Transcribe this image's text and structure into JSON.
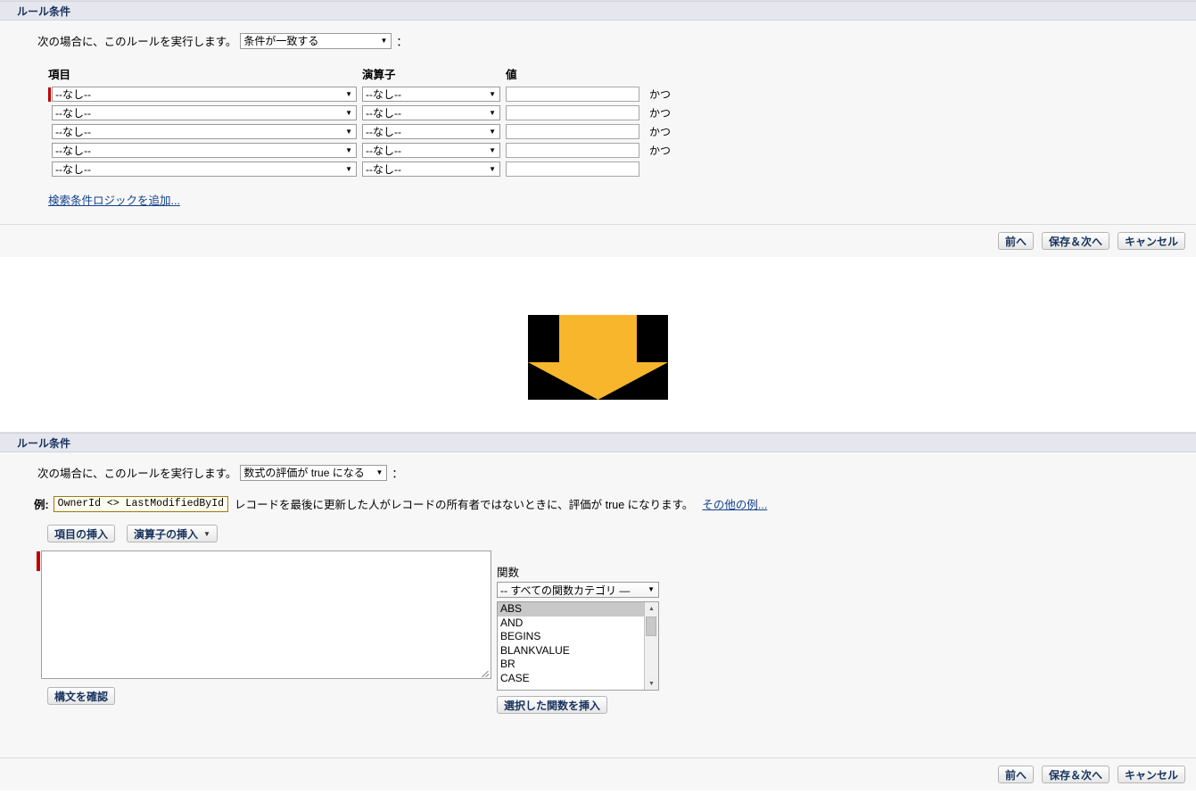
{
  "panel_criteria": {
    "header_title": "ルール条件",
    "intro_lead": "次の場合に、このルールを実行します。",
    "intro_select_value": "条件が一致する",
    "intro_colon": "：",
    "columns": [
      "項目",
      "演算子",
      "値"
    ],
    "rows": [
      {
        "field": "--なし--",
        "operator": "--なし--",
        "value": "",
        "conjunction": "かつ",
        "required": true
      },
      {
        "field": "--なし--",
        "operator": "--なし--",
        "value": "",
        "conjunction": "かつ",
        "required": false
      },
      {
        "field": "--なし--",
        "operator": "--なし--",
        "value": "",
        "conjunction": "かつ",
        "required": false
      },
      {
        "field": "--なし--",
        "operator": "--なし--",
        "value": "",
        "conjunction": "かつ",
        "required": false
      },
      {
        "field": "--なし--",
        "operator": "--なし--",
        "value": "",
        "conjunction": "",
        "required": false
      }
    ],
    "add_logic_link": "検索条件ロジックを追加...",
    "footer_buttons": {
      "previous": "前へ",
      "save_next": "保存＆次へ",
      "cancel": "キャンセル"
    }
  },
  "arrow": {
    "icon": "arrow-down-icon",
    "fill_color": "#F7B62C",
    "background_color": "#000000"
  },
  "panel_formula": {
    "header_title": "ルール条件",
    "intro_lead": "次の場合に、このルールを実行します。",
    "intro_select_value": "数式の評価が true になる",
    "intro_colon": "：",
    "example_label": "例:",
    "example_formula": "OwnerId <> LastModifiedById",
    "example_text": "レコードを最後に更新した人がレコードの所有者ではないときに、評価が true になります。",
    "example_link": "その他の例...",
    "insert_field_button": "項目の挿入",
    "insert_operator_button": "演算子の挿入",
    "formula_textarea_value": "",
    "check_syntax_button": "構文を確認",
    "functions": {
      "label": "関数",
      "category_value": "-- すべての関数カテゴリ —",
      "items": [
        "ABS",
        "AND",
        "BEGINS",
        "BLANKVALUE",
        "BR",
        "CASE"
      ],
      "selected_item": "ABS",
      "insert_button": "選択した関数を挿入"
    },
    "footer_buttons": {
      "previous": "前へ",
      "save_next": "保存＆次へ",
      "cancel": "キャンセル"
    }
  }
}
